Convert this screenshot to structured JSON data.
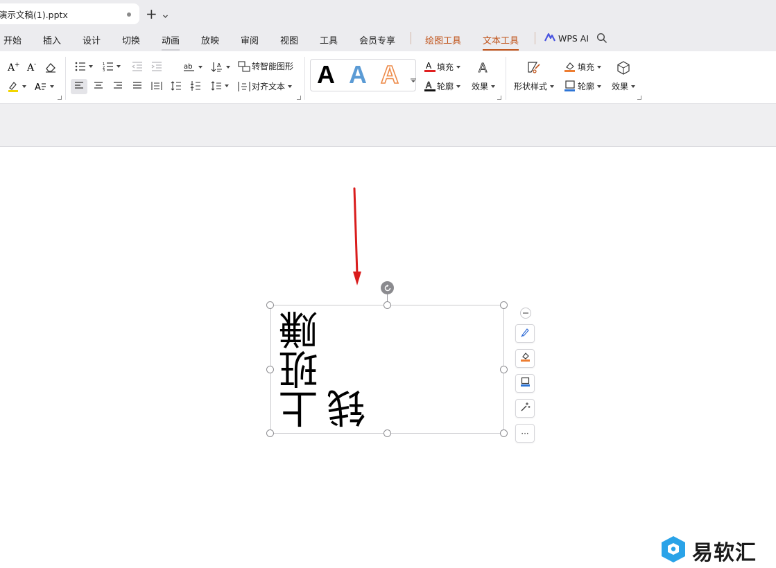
{
  "titlebar": {
    "doc_tab_name": "演示文稿(1).pptx",
    "new_tab_label": "+"
  },
  "menu": {
    "items": [
      "开始",
      "插入",
      "设计",
      "切换",
      "动画",
      "放映",
      "审阅",
      "视图",
      "工具",
      "会员专享"
    ],
    "active_item": "动画",
    "context_tabs": [
      "绘图工具",
      "文本工具"
    ],
    "active_context_tab": "文本工具",
    "ai_label": "WPS AI"
  },
  "ribbon": {
    "smart_graphic_label": "转智能图形",
    "align_text_label": "对齐文本",
    "text_fill_label": "填充",
    "text_outline_label": "轮廓",
    "text_effect_label": "效果",
    "shape_style_label": "形状样式",
    "shape_fill_label": "填充",
    "shape_outline_label": "轮廓",
    "shape_effect_label": "效果",
    "wordart_sample": "A"
  },
  "slide": {
    "textbox_line1": "上班赚",
    "textbox_line2": "钱"
  },
  "floating_toolbar": {
    "more_label": "···"
  },
  "watermark": {
    "text": "易软汇"
  },
  "colors": {
    "accent_orange": "#c0531a",
    "arrow_red": "#d91c1c",
    "wordart_blue": "#5b9bd5",
    "wordart_orange": "#ed8b4a"
  }
}
